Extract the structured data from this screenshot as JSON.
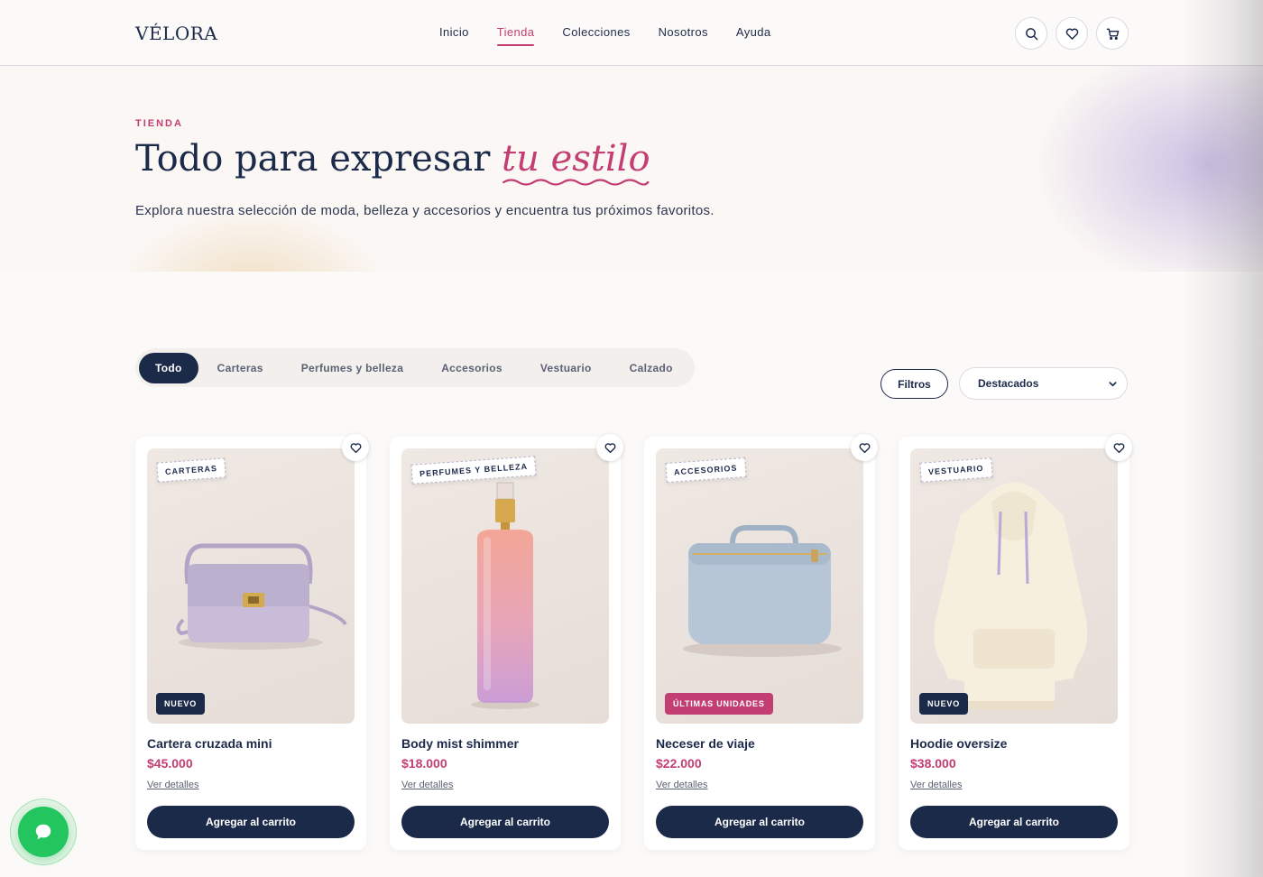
{
  "brand": {
    "logo": "VÉLORA"
  },
  "nav": {
    "items": [
      {
        "label": "Inicio",
        "active": false
      },
      {
        "label": "Tienda",
        "active": true
      },
      {
        "label": "Colecciones",
        "active": false
      },
      {
        "label": "Nosotros",
        "active": false
      },
      {
        "label": "Ayuda",
        "active": false
      }
    ]
  },
  "header_icons": [
    "search-icon",
    "heart-icon",
    "cart-icon"
  ],
  "hero": {
    "eyebrow": "TIENDA",
    "title_main": "Todo para expresar ",
    "title_accent": "tu estilo",
    "subtitle": "Explora nuestra selección de moda, belleza y accesorios y encuentra tus próximos favoritos."
  },
  "filters": {
    "chips": [
      {
        "label": "Todo",
        "active": true
      },
      {
        "label": "Carteras",
        "active": false
      },
      {
        "label": "Perfumes y belleza",
        "active": false
      },
      {
        "label": "Accesorios",
        "active": false
      },
      {
        "label": "Vestuario",
        "active": false
      },
      {
        "label": "Calzado",
        "active": false
      }
    ],
    "filter_button": "Filtros",
    "sort_selected": "Destacados"
  },
  "products": [
    {
      "category": "CARTERAS",
      "badge": "NUEVO",
      "badge_color": "#1c2a4a",
      "name": "Cartera cruzada mini",
      "price": "$45.000",
      "details": "Ver detalles",
      "cta": "Agregar al carrito",
      "art": "bag"
    },
    {
      "category": "PERFUMES Y BELLEZA",
      "badge": "",
      "badge_color": "",
      "name": "Body mist shimmer",
      "price": "$18.000",
      "details": "Ver detalles",
      "cta": "Agregar al carrito",
      "art": "mist"
    },
    {
      "category": "ACCESORIOS",
      "badge": "ÚLTIMAS UNIDADES",
      "badge_color": "#c33e72",
      "name": "Neceser de viaje",
      "price": "$22.000",
      "details": "Ver detalles",
      "cta": "Agregar al carrito",
      "art": "case"
    },
    {
      "category": "VESTUARIO",
      "badge": "NUEVO",
      "badge_color": "#1c2a4a",
      "name": "Hoodie oversize",
      "price": "$38.000",
      "details": "Ver detalles",
      "cta": "Agregar al carrito",
      "art": "hoodie"
    }
  ],
  "colors": {
    "accent": "#c33e72",
    "navy": "#1c2a4a",
    "chat": "#22c55e"
  }
}
